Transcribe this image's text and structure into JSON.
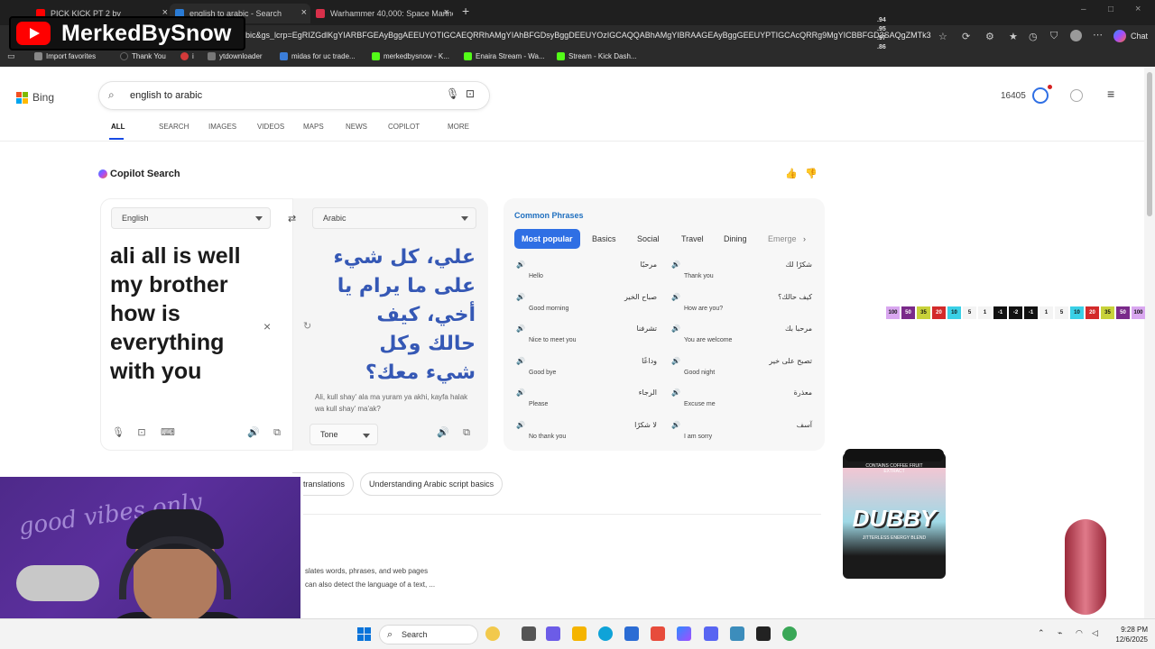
{
  "browser": {
    "tabs": [
      {
        "title": "PICK KICK PT 2 by",
        "active": false
      },
      {
        "title": "english to arabic - Search",
        "active": true
      },
      {
        "title": "Warhammer 40,000: Space Marine",
        "active": false
      }
    ],
    "url": "bic&gs_lcrp=EgRIZGdlKgYIARBFGEAyBggAEEUYOTIGCAEQRRhAMgYIAhBFGDsyBggDEEUYOzIGCAQQABhAMgYIBRAAGEAyBggGEEUYPTIGCAcQRRg9MgYICBBFGD3SAQgZMTk3ajBqM...",
    "right_label": "Chat",
    "favorites": [
      {
        "label": "Import favorites",
        "color": "#888888"
      },
      {
        "label": "Thank You",
        "color": "#222222"
      },
      {
        "label": "i",
        "color": "#d33a3a"
      },
      {
        "label": "ytdownloader",
        "color": "#777777"
      },
      {
        "label": "midas for uc trade...",
        "color": "#3b7dd8"
      },
      {
        "label": "merkedbysnow - K...",
        "color": "#53fc18"
      },
      {
        "label": "Enaira Stream - Wa...",
        "color": "#53fc18"
      },
      {
        "label": "Stream - Kick Dash...",
        "color": "#53fc18"
      }
    ]
  },
  "overlay": {
    "channel_name": "MerkedBySnow",
    "alerts": [
      ".94",
      ".95",
      ".97",
      ".86"
    ],
    "webcam_text": "good vibes only",
    "counter_values": [
      "100",
      "50",
      "35",
      "20",
      "10",
      "5",
      "1",
      "-1",
      "-2",
      "-1",
      "1",
      "5",
      "10",
      "20",
      "35",
      "50",
      "100"
    ],
    "ad_brand": "DUBBY",
    "ad_tag": "CONTAINS COFFEE FRUIT EXTRACT",
    "ad_sub": "JITTERLESS ENERGY BLEND"
  },
  "bing": {
    "logo": "Bing",
    "query": "english to arabic",
    "points": "16405",
    "scopes": [
      "ALL",
      "SEARCH",
      "IMAGES",
      "VIDEOS",
      "MAPS",
      "NEWS",
      "COPILOT",
      "MORE"
    ],
    "copilot_title": "Copilot Search"
  },
  "translator": {
    "source_lang": "English",
    "target_lang": "Arabic",
    "source_text": "ali all is well my brother how is everything with you",
    "target_text": "علي، كل شيء على ما يرام يا أخي، كيف حالك وكل شيء معك؟",
    "transliteration": "Ali, kull shay' ala ma yuram ya akhi, kayfa halak wa kull shay' ma'ak?",
    "tone_label": "Tone"
  },
  "phrases": {
    "title": "Common Phrases",
    "tabs": [
      "Most popular",
      "Basics",
      "Social",
      "Travel",
      "Dining",
      "Emerge"
    ],
    "items": [
      {
        "ar": "مرحبًا",
        "en": "Hello"
      },
      {
        "ar": "شكرًا لك",
        "en": "Thank you"
      },
      {
        "ar": "صباح الخير",
        "en": "Good morning"
      },
      {
        "ar": "كيف حالك؟",
        "en": "How are you?"
      },
      {
        "ar": "تشرفنا",
        "en": "Nice to meet you"
      },
      {
        "ar": "مرحبا بك",
        "en": "You are welcome"
      },
      {
        "ar": "وداعًا",
        "en": "Good bye"
      },
      {
        "ar": "تصبح على خير",
        "en": "Good night"
      },
      {
        "ar": "الرجاء",
        "en": "Please"
      },
      {
        "ar": "معذرة",
        "en": "Excuse me"
      },
      {
        "ar": "لا شكرًا",
        "en": "No thank you"
      },
      {
        "ar": "آسف",
        "en": "I am sorry"
      }
    ]
  },
  "chips": [
    "translations",
    "Understanding Arabic script basics"
  ],
  "description": {
    "line1": "slates words, phrases, and web pages",
    "line2": "can also detect the language of a text, ..."
  },
  "taskbar": {
    "search_label": "Search",
    "time": "9:28 PM",
    "date": "12/6/2025"
  }
}
